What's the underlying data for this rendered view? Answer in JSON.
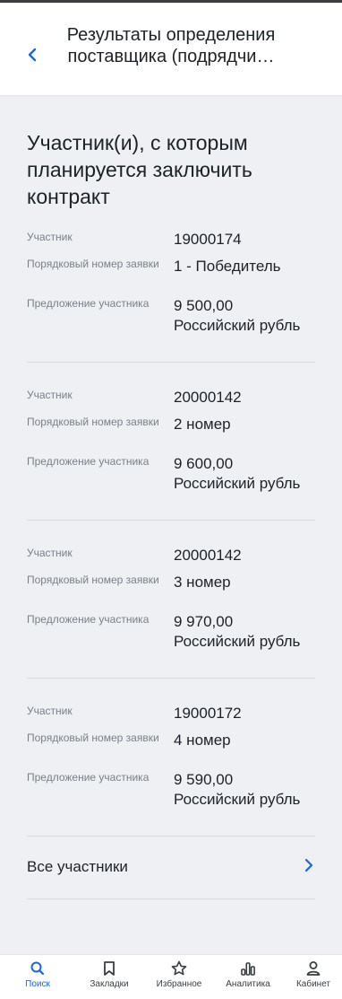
{
  "header": {
    "title": "Результаты определения поставщика (подрядчи…"
  },
  "section_title": "Участник(и), с которым планируется заключить контракт",
  "labels": {
    "participant": "Участник",
    "application_number": "Порядковый номер заявки",
    "offer": "Предложение участника"
  },
  "participants": [
    {
      "participant": "19000174",
      "application_number": "1 - Победитель",
      "offer_amount": "9 500,00",
      "offer_currency": "Российский рубль"
    },
    {
      "participant": "20000142",
      "application_number": "2 номер",
      "offer_amount": "9 600,00",
      "offer_currency": "Российский рубль"
    },
    {
      "participant": "20000142",
      "application_number": "3 номер",
      "offer_amount": "9 970,00",
      "offer_currency": "Российский рубль"
    },
    {
      "participant": "19000172",
      "application_number": "4 номер",
      "offer_amount": "9 590,00",
      "offer_currency": "Российский рубль"
    }
  ],
  "all_participants_label": "Все участники",
  "tabbar": {
    "items": [
      {
        "label": "Поиск",
        "icon": "search-icon",
        "active": true
      },
      {
        "label": "Закладки",
        "icon": "bookmark-icon",
        "active": false
      },
      {
        "label": "Избранное",
        "icon": "star-icon",
        "active": false
      },
      {
        "label": "Аналитика",
        "icon": "analytics-icon",
        "active": false
      },
      {
        "label": "Кабинет",
        "icon": "user-icon",
        "active": false
      }
    ]
  },
  "colors": {
    "accent": "#1a66e0",
    "background": "#eef0f3",
    "text": "#1d2128",
    "muted": "#7a8089"
  }
}
